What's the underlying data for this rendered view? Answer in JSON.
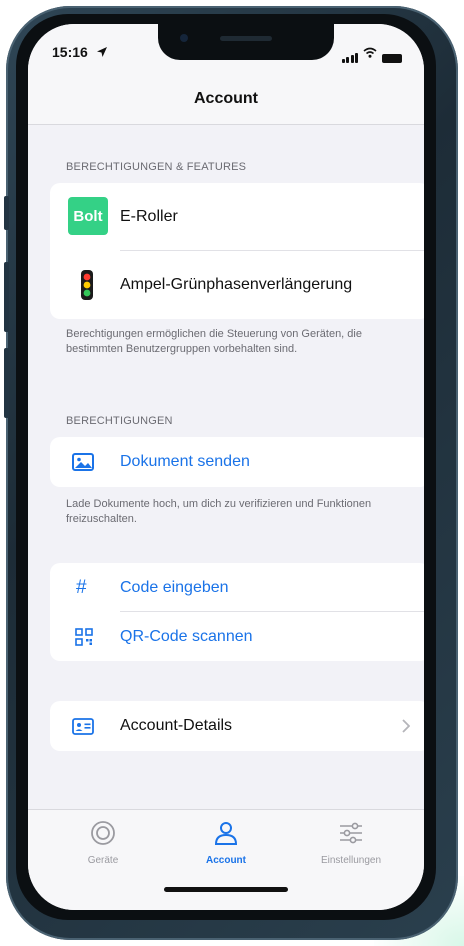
{
  "status_bar": {
    "time": "15:16"
  },
  "nav": {
    "title": "Account"
  },
  "permissions_features": {
    "header": "BERECHTIGUNGEN & FEATURES",
    "items": [
      {
        "label": "E-Roller",
        "logo_text": "Bolt",
        "icon": "bolt-logo"
      },
      {
        "label": "Ampel-Grünphasenverlängerung",
        "icon": "traffic-light-icon"
      }
    ],
    "footer": "Berechtigungen ermöglichen die Steuerung von Geräten, die bestimmten Benutzergruppen vorbehalten sind."
  },
  "permissions": {
    "header": "BERECHTIGUNGEN",
    "items": [
      {
        "label": "Dokument senden",
        "icon": "image-icon"
      }
    ],
    "footer": "Lade Dokumente hoch, um dich zu verifizieren und Funktionen freizuschalten."
  },
  "codes": {
    "items": [
      {
        "label": "Code eingeben",
        "icon_glyph": "#",
        "icon": "hash-icon"
      },
      {
        "label": "QR-Code scannen",
        "icon": "qr-code-icon"
      }
    ]
  },
  "account_details": {
    "label": "Account-Details",
    "icon": "id-card-icon",
    "chevron": "chevron-right-icon"
  },
  "tabbar": {
    "tabs": [
      {
        "label": "Geräte",
        "icon": "devices-icon",
        "active": false
      },
      {
        "label": "Account",
        "icon": "person-icon",
        "active": true
      },
      {
        "label": "Einstellungen",
        "icon": "sliders-icon",
        "active": false
      }
    ]
  },
  "colors": {
    "accent": "#1a73e8",
    "bolt_green": "#34d186",
    "background": "#f2f2f7"
  }
}
